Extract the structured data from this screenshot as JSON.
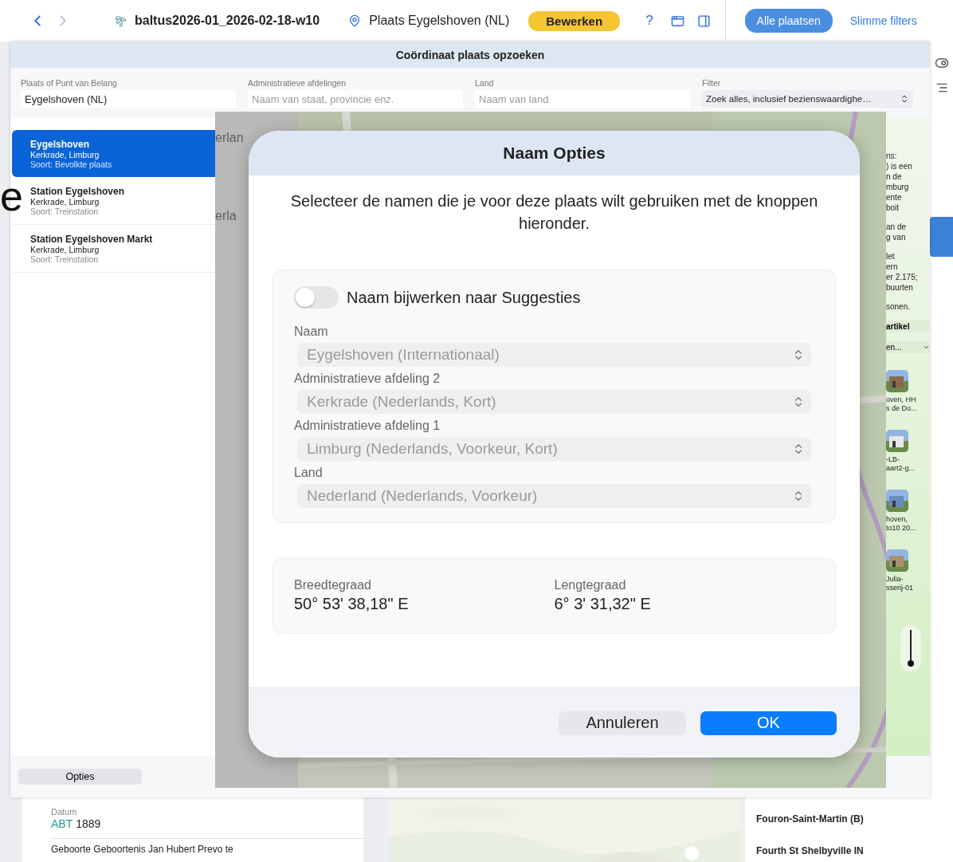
{
  "toolbar": {
    "title": "baltus2026-01_2026-02-18-w10",
    "location": "Plaats Eygelshoven (NL)",
    "edit_button": "Bewerken",
    "help": "?",
    "all_places_button": "Alle plaatsen",
    "smart_filters_link": "Slimme filters"
  },
  "sheet": {
    "title": "Coördinaat plaats opzoeken",
    "fields": [
      {
        "label": "Plaats of Punt van Belang",
        "value": "Eygelshoven (NL)",
        "kind": "text"
      },
      {
        "label": "Administratieve afdelingen",
        "placeholder": "Naam van staat, provincie enz.",
        "kind": "text"
      },
      {
        "label": "Land",
        "placeholder": "Naam van land",
        "kind": "text"
      },
      {
        "label": "Filter",
        "value": "Zoek alles, inclusief bezienswaardighe…",
        "kind": "select"
      }
    ],
    "results": [
      {
        "name": "Eygelshoven",
        "region": "Kerkrade, Limburg",
        "type": "Soort: Bevolkte plaats",
        "selected": true
      },
      {
        "name": "Station Eygelshoven",
        "region": "Kerkrade, Limburg",
        "type": "Soort: Treinstation",
        "selected": false
      },
      {
        "name": "Station Eygelshoven Markt",
        "region": "Kerkrade, Limburg",
        "type": "Soort: Treinstation",
        "selected": false
      }
    ],
    "options_button": "Opties",
    "article": {
      "paragraphs": [
        [
          "ns:",
          ") is een",
          "n de",
          "mburg",
          "ente",
          "boit"
        ],
        [
          "an de",
          "g van"
        ],
        [
          "let",
          "ern",
          "er 2.175;",
          "buurten"
        ],
        [
          "sonen."
        ]
      ],
      "article_button": "artikel",
      "more_dropdown": "en...",
      "thumbnails": [
        {
          "caption": [
            "oven, HH",
            "s de Do..."
          ]
        },
        {
          "caption": [
            "-LB-",
            "aart2-g..."
          ]
        },
        {
          "caption": [
            "hoven,",
            "to10 20..."
          ]
        },
        {
          "caption": [
            "Julia-",
            "sserij-01"
          ]
        }
      ]
    }
  },
  "overlay": {
    "fragments": [
      "erlan",
      "erla"
    ]
  },
  "dialog": {
    "title": "Naam Opties",
    "description": "Selecteer de namen die je voor deze plaats wilt gebruiken met de knoppen hieronder.",
    "toggle": {
      "label": "Naam bijwerken naar Suggesties",
      "on": false
    },
    "selects": [
      {
        "label": "Naam",
        "value": "Eygelshoven (Internationaal)",
        "disabled": true
      },
      {
        "label": "Administratieve afdeling 2",
        "value": "Kerkrade (Nederlands, Kort)",
        "disabled": true
      },
      {
        "label": "Administratieve afdeling 1",
        "value": "Limburg (Nederlands, Voorkeur, Kort)",
        "disabled": true
      },
      {
        "label": "Land",
        "value": "Nederland (Nederlands, Voorkeur)",
        "disabled": true
      }
    ],
    "coordinates": [
      {
        "label": "Breedtegraad",
        "value": "50° 53' 38,18\" E"
      },
      {
        "label": "Lengtegraad",
        "value": "6° 3' 31,32\" E"
      }
    ],
    "buttons": [
      {
        "label": "Annuleren",
        "kind": "secondary"
      },
      {
        "label": "OK",
        "kind": "primary"
      }
    ]
  },
  "background": {
    "stray_letter": "e",
    "date_label": "Datum",
    "date_qualifier": "ABT",
    "date": "1889",
    "event": "Geboorte Geboortenis Jan Hubert Prevo te",
    "places": [
      "Fouron-Saint-Martin (B)",
      "Fourth St Shelbyville IN"
    ]
  }
}
